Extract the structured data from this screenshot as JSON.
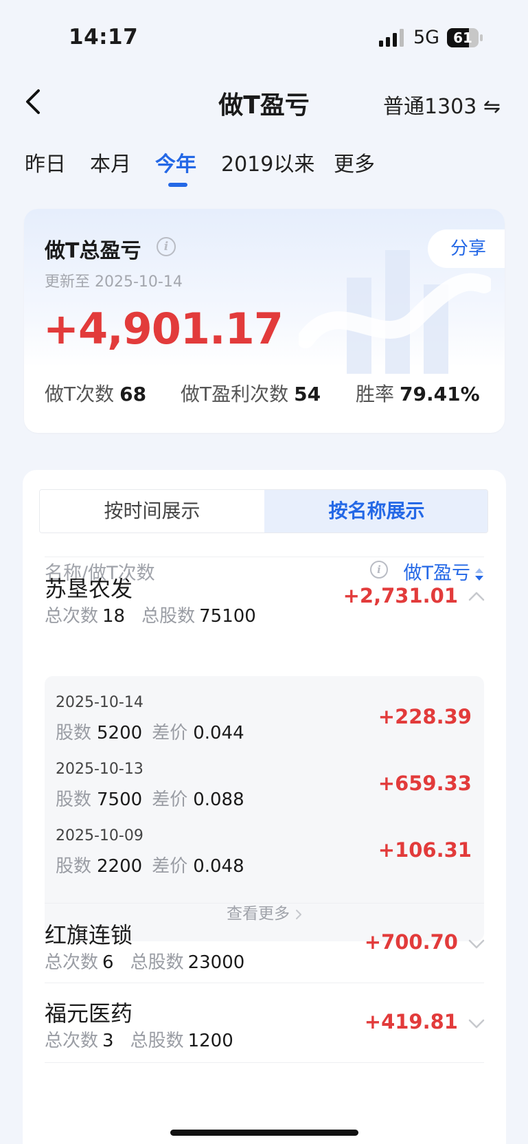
{
  "status_bar": {
    "time": "14:17",
    "network": "5G",
    "battery": "61"
  },
  "header": {
    "title": "做T盈亏",
    "account": "普通1303 ⇋"
  },
  "tabs": [
    {
      "label": "昨日",
      "active": false
    },
    {
      "label": "本月",
      "active": false
    },
    {
      "label": "今年",
      "active": true
    },
    {
      "label": "2019以来",
      "active": false
    },
    {
      "label": "更多",
      "active": false
    }
  ],
  "summary": {
    "title": "做T总盈亏",
    "share_label": "分享",
    "updated": "更新至 2025-10-14",
    "total": "+4,901.17",
    "stats": [
      {
        "label": "做T次数",
        "value": "68"
      },
      {
        "label": "做T盈利次数",
        "value": "54"
      },
      {
        "label": "胜率",
        "value": "79.41%"
      }
    ]
  },
  "list": {
    "segments": {
      "by_time": "按时间展示",
      "by_name": "按名称展示",
      "active": "by_name"
    },
    "column_left": "名称/做T次数",
    "column_right": "做T盈亏",
    "sub_labels": {
      "count": "总次数",
      "shares": "总股数",
      "detail_shares": "股数",
      "detail_diff": "差价"
    },
    "stocks": [
      {
        "name": "苏垦农发",
        "count": "18",
        "shares": "75100",
        "pl": "+2,731.01",
        "expanded": true,
        "details": [
          {
            "date": "2025-10-14",
            "shares": "5200",
            "diff": "0.044",
            "pl": "+228.39"
          },
          {
            "date": "2025-10-13",
            "shares": "7500",
            "diff": "0.088",
            "pl": "+659.33"
          },
          {
            "date": "2025-10-09",
            "shares": "2200",
            "diff": "0.048",
            "pl": "+106.31"
          }
        ],
        "more_label": "查看更多"
      },
      {
        "name": "红旗连锁",
        "count": "6",
        "shares": "23000",
        "pl": "+700.70",
        "expanded": false
      },
      {
        "name": "福元医药",
        "count": "3",
        "shares": "1200",
        "pl": "+419.81",
        "expanded": false
      }
    ]
  },
  "colors": {
    "accent": "#2468e6",
    "profit": "#e23b3b",
    "muted": "#9a9da4"
  }
}
